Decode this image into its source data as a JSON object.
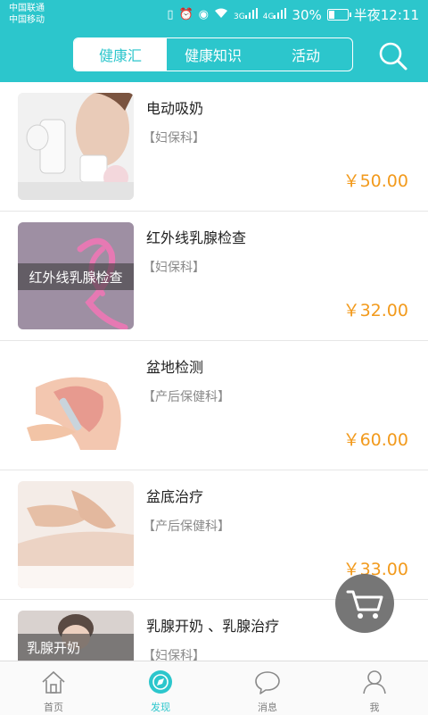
{
  "status_bar": {
    "carrier1": "中国联通",
    "carrier2": "中国移动",
    "network1": "3G",
    "network2": "4G",
    "battery": "30%",
    "battery_level": 0.3,
    "time": "半夜12:11"
  },
  "header": {
    "tabs": [
      {
        "label": "健康汇",
        "active": true
      },
      {
        "label": "健康知识",
        "active": false
      },
      {
        "label": "活动",
        "active": false
      }
    ]
  },
  "items": [
    {
      "title": "电动吸奶",
      "dept": "【妇保科】",
      "price": "￥50.00",
      "caption": ""
    },
    {
      "title": "红外线乳腺检查",
      "dept": "【妇保科】",
      "price": "￥32.00",
      "caption": "红外线乳腺检查"
    },
    {
      "title": "盆地检测",
      "dept": "【产后保健科】",
      "price": "￥60.00",
      "caption": ""
    },
    {
      "title": "盆底治疗",
      "dept": "【产后保健科】",
      "price": "￥33.00",
      "caption": ""
    },
    {
      "title": "乳腺开奶 、乳腺治疗",
      "dept": "【妇保科】",
      "price": "",
      "caption": "乳腺开奶"
    }
  ],
  "bottom_nav": [
    {
      "label": "首页",
      "active": false
    },
    {
      "label": "发现",
      "active": true
    },
    {
      "label": "消息",
      "active": false
    },
    {
      "label": "我",
      "active": false
    }
  ],
  "colors": {
    "accent": "#2cc6cc",
    "price": "#f29a1c"
  }
}
